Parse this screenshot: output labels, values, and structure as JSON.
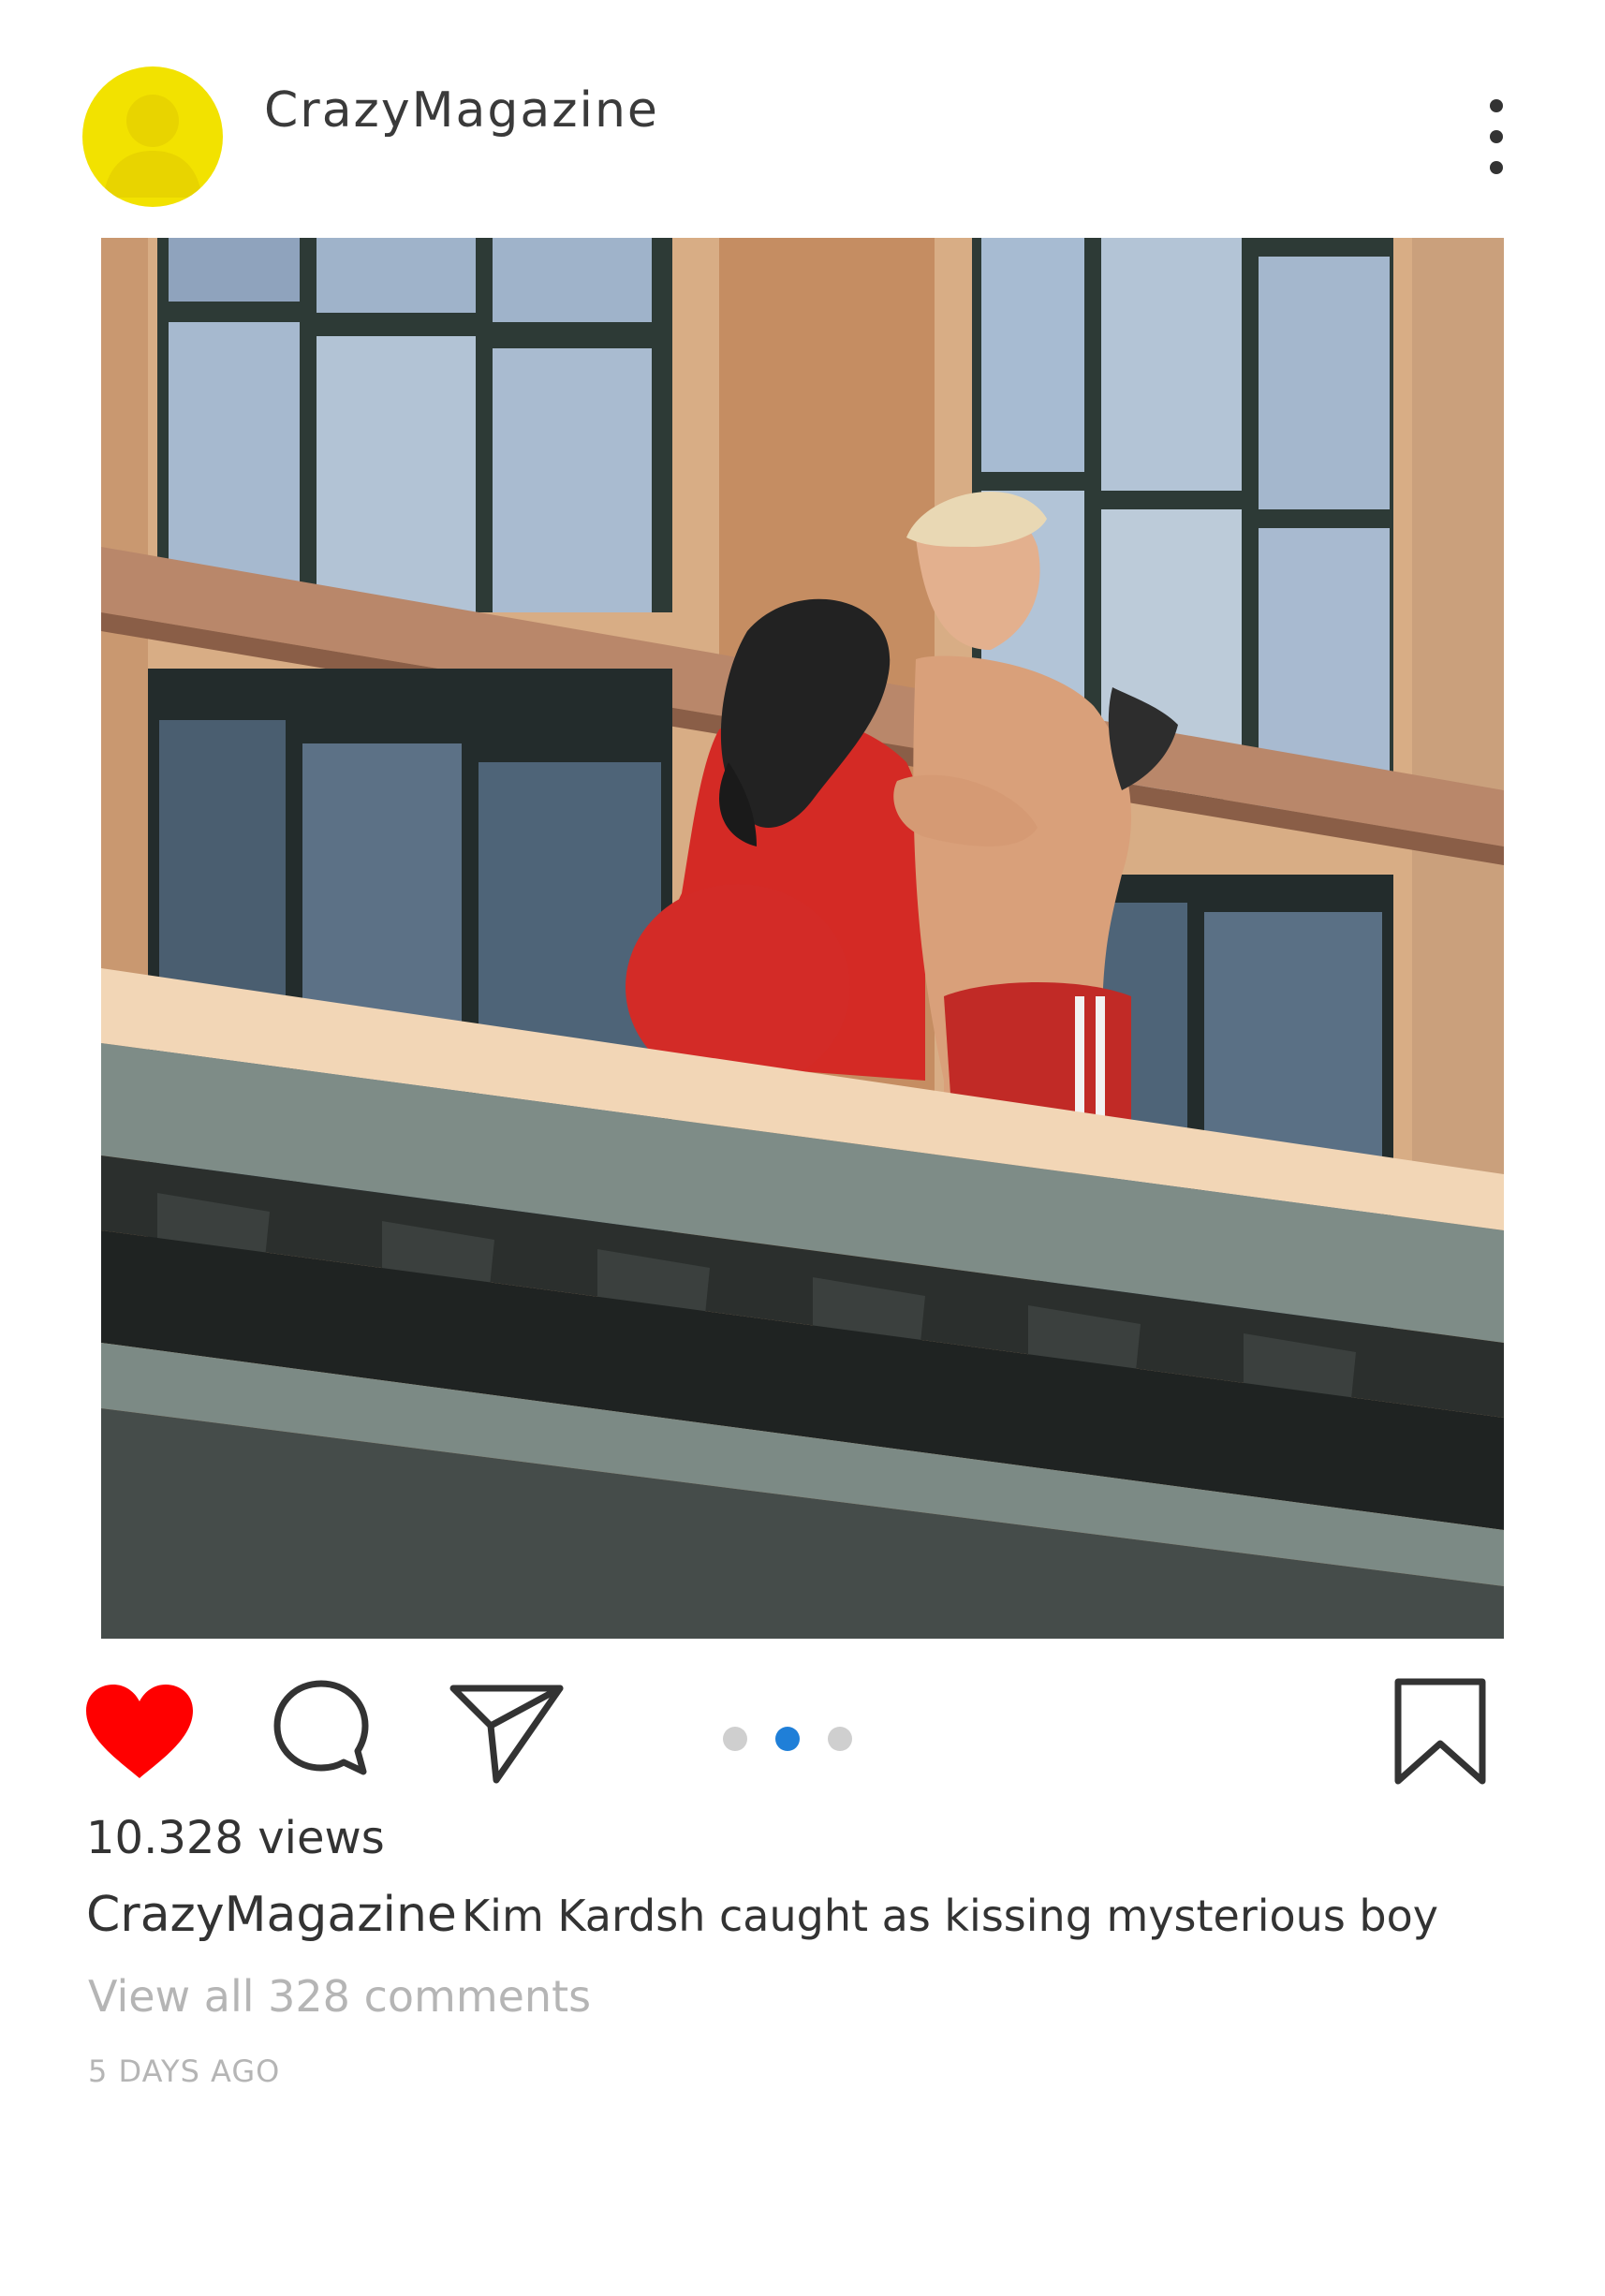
{
  "post": {
    "username": "CrazyMagazine",
    "views": "10.328 views",
    "caption_user": "CrazyMagazine",
    "caption_text": "Kim Kardsh caught as kissing mysterious boy",
    "view_comments": "View all 328 comments",
    "time_ago": "5 DAYS AGO",
    "liked": true,
    "carousel": {
      "count": 3,
      "active_index": 1
    }
  },
  "colors": {
    "avatar": "#f2e200",
    "like": "#ff0000",
    "carousel_active": "#1f7fd8",
    "carousel_inactive": "#cfcfcf"
  },
  "icons": {
    "avatar": "user-silhouette-icon",
    "more": "more-vertical-icon",
    "like": "heart-icon",
    "comment": "comment-bubble-icon",
    "share": "paper-plane-icon",
    "save": "bookmark-icon"
  }
}
